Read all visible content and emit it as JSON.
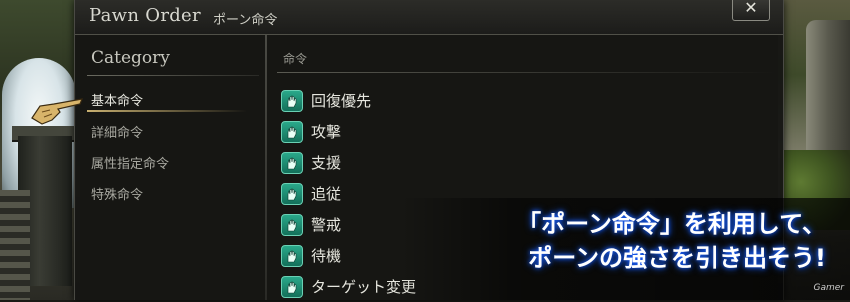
{
  "window": {
    "title_en": "Pawn Order",
    "title_ja": "ポーン命令",
    "close_label": "✕"
  },
  "category": {
    "header": "Category",
    "items": [
      {
        "label": "基本命令",
        "selected": true
      },
      {
        "label": "詳細命令",
        "selected": false
      },
      {
        "label": "属性指定命令",
        "selected": false
      },
      {
        "label": "特殊命令",
        "selected": false
      }
    ]
  },
  "commands": {
    "header": "命令",
    "items": [
      {
        "label": "回復優先",
        "icon": "pawn-hand-icon"
      },
      {
        "label": "攻撃",
        "icon": "pawn-hand-icon"
      },
      {
        "label": "支援",
        "icon": "pawn-hand-icon"
      },
      {
        "label": "追従",
        "icon": "pawn-hand-icon"
      },
      {
        "label": "警戒",
        "icon": "pawn-hand-icon"
      },
      {
        "label": "待機",
        "icon": "pawn-hand-icon"
      },
      {
        "label": "ターゲット変更",
        "icon": "pawn-hand-icon"
      }
    ]
  },
  "caption": {
    "line1": "「ポーン命令」を利用して、",
    "line2": "ポーンの強さを引き出そう!"
  },
  "watermark": "Gamer",
  "colors": {
    "icon_teal": "#1f8a70",
    "caption_glow": "#1a60ff",
    "selection_gold": "#c8b070"
  }
}
